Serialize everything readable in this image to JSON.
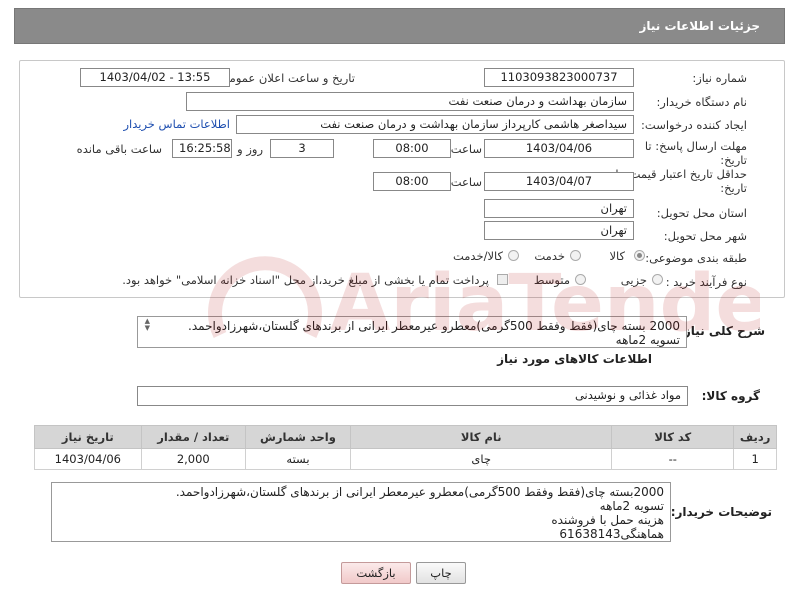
{
  "header": {
    "title": "جزئیات اطلاعات نیاز"
  },
  "form": {
    "need_number_label": "شماره نیاز:",
    "need_number": "1103093823000737",
    "announce_label": "تاریخ و ساعت اعلان عمومی:",
    "announce_value": "1403/04/02 - 13:55",
    "buyer_org_label": "نام دستگاه خریدار:",
    "buyer_org": "سازمان بهداشت و درمان صنعت نفت",
    "creator_label": "ایجاد کننده درخواست:",
    "creator": "سیداصغر هاشمی کارپرداز سازمان بهداشت و درمان صنعت نفت",
    "contact_link": "اطلاعات تماس خریدار",
    "deadline_label_1": "مهلت ارسال پاسخ: تا",
    "deadline_label_2": "تاریخ:",
    "deadline_date": "1403/04/06",
    "time_label": "ساعت",
    "deadline_time": "08:00",
    "days_value": "3",
    "days_label": "روز و",
    "remaining_time": "16:25:58",
    "remaining_label": "ساعت باقی مانده",
    "validity_label_1": "حداقل تاریخ اعتبار قیمت: تا",
    "validity_label_2": "تاریخ:",
    "validity_date": "1403/04/07",
    "validity_time": "08:00",
    "province_label": "استان محل تحویل:",
    "province": "تهران",
    "city_label": "شهر محل تحویل:",
    "city": "تهران",
    "category_label": "طبقه بندی موضوعی:",
    "category_options": [
      "کالا",
      "خدمت",
      "کالا/خدمت"
    ],
    "category_selected": "کالا",
    "process_label": "نوع فرآیند خرید :",
    "process_options": [
      "جزیی",
      "متوسط"
    ],
    "payment_note": "پرداخت تمام یا بخشی از مبلغ خرید،از محل \"اسناد خزانه اسلامی\" خواهد بود."
  },
  "description": {
    "label": "شرح کلی نیاز:",
    "line1": "2000 بسته چای(فقط وفقط 500گرمی)معطرو عیرمعطر ایرانی از برندهای گلستان،شهرزادواحمد.",
    "line2": "تسویه 2ماهه"
  },
  "goods": {
    "section_title": "اطلاعات کالاهای مورد نیاز",
    "group_label": "گروه کالا:",
    "group_value": "مواد غذائی و نوشیدنی",
    "columns": [
      "ردیف",
      "کد کالا",
      "نام کالا",
      "واحد شمارش",
      "تعداد / مقدار",
      "تاریخ نیاز"
    ],
    "rows": [
      {
        "row": "1",
        "code": "--",
        "name": "چای",
        "unit": "بسته",
        "qty": "2,000",
        "date": "1403/04/06"
      }
    ]
  },
  "buyer_notes": {
    "label": "توضیحات خریدار:",
    "lines": [
      "2000بسته چای(فقط وفقط 500گرمی)معطرو عیرمعطر ایرانی از برندهای گلستان،شهرزادواحمد.",
      "تسویه 2ماهه",
      "هزینه حمل با فروشنده",
      "هماهنگی61638143"
    ]
  },
  "buttons": {
    "print": "چاپ",
    "back": "بازگشت"
  },
  "watermark": {
    "text": "AriaTender.neT"
  }
}
